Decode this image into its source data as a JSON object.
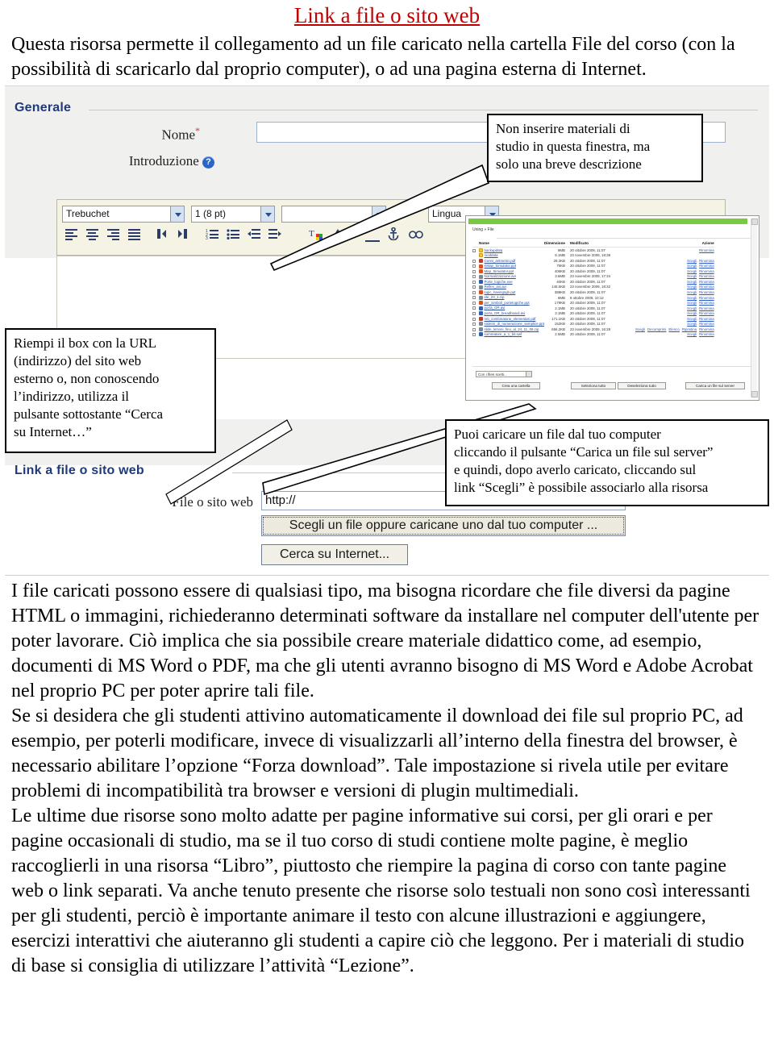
{
  "document": {
    "title": "Link a file o sito web",
    "intro": "Questa risorsa permette il collegamento ad un file caricato nella cartella File del corso (con la possibilità di scaricarlo dal proprio computer), o ad una pagina esterna di Internet.",
    "paragraph_1": "I file caricati possono essere di qualsiasi tipo, ma bisogna ricordare che file diversi da pagine HTML o immagini, richiederanno determinati software da installare nel computer dell'utente per poter lavorare. Ciò implica che sia possibile creare materiale didattico come, ad esempio, documenti di MS Word o PDF, ma che gli utenti avranno bisogno di MS Word e Adobe Acrobat nel proprio PC per poter aprire tali file.",
    "paragraph_2": "Se si desidera che gli studenti attivino automaticamente il download dei file sul proprio PC, ad esempio, per poterli modificare, invece di visualizzarli all’interno della finestra del browser, è necessario abilitare l’opzione “Forza download”. Tale impostazione si rivela utile per evitare problemi di incompatibilità tra browser e versioni di plugin multimediali.",
    "paragraph_3": "Le ultime due risorse sono molto adatte per pagine informative sui corsi, per gli orari e per pagine occasionali di studio, ma se il tuo corso di studi contiene molte pagine, è meglio raccoglierli in una risorsa  “Libro”, piuttosto che riempire la pagina di corso con tante pagine web o link separati. Va anche tenuto presente che risorse solo testuali non sono così interessanti per gli studenti, perciò è importante animare il testo con alcune illustrazioni e aggiungere, esercizi interattivi che aiuteranno gli studenti a capire ciò che leggono. Per i materiali di studio di base si consiglia di utilizzare l’attività “Lezione”."
  },
  "colors": {
    "title_red": "#c00000",
    "legend_blue": "#1f3a7a",
    "link_blue": "#2a4fa0",
    "green_bar": "#7ac943"
  },
  "screenshot": {
    "sections": {
      "generale": "Generale",
      "link_a_file": "Link a file o sito web"
    },
    "form": {
      "nome_label": "Nome",
      "nome_value": "",
      "nome_required_mark": "*",
      "introduzione_label": "Introduzione",
      "help_icon_glyph": "?",
      "file_o_sito_web_label": "File o sito web",
      "url_value": "http://",
      "choose_button": "Scegli un file oppure caricane uno dal tuo computer ...",
      "search_button": "Cerca su Internet..."
    },
    "editor": {
      "font_family": "Trebuchet",
      "font_size": "1 (8 pt)",
      "format": "",
      "language": "Lingua",
      "toolbar_icons": [
        "align-left-icon",
        "align-center-icon",
        "align-right-icon",
        "align-justify-icon",
        "direction-ltr-icon",
        "direction-rtl-icon",
        "numbered-list-icon",
        "bulleted-list-icon",
        "outdent-icon",
        "indent-icon",
        "text-color-icon",
        "background-color-icon",
        "horizontal-rule-icon",
        "anchor-icon",
        "insert-link-icon"
      ]
    },
    "file_manager": {
      "breadcrumb": "Uning » File",
      "columns": [
        "Nome",
        "Dimensione",
        "Modificato",
        "Azione"
      ],
      "rows": [
        {
          "checkbox": true,
          "icon": "folder-icon",
          "name": "backupdata",
          "size": "9MB",
          "modified": "20 ottobre 2009, 11:07",
          "actions": [
            "Rinomina"
          ]
        },
        {
          "checkbox": false,
          "icon": "folder-icon",
          "name": "moddata",
          "size": "8.1MB",
          "modified": "23 novembre 2009, 18:38",
          "actions": []
        },
        {
          "checkbox": true,
          "icon": "pdf-icon",
          "name": "Cenni_aritmetici.pdf",
          "size": "29.3KB",
          "modified": "20 ottobre 2009, 11:07",
          "actions": [
            "Scegli",
            "Rinomina"
          ]
        },
        {
          "checkbox": true,
          "icon": "ppt-icon",
          "name": "KMap_Simulator.ppt",
          "size": "75KB",
          "modified": "20 ottobre 2009, 11:07",
          "actions": [
            "Scegli",
            "Rinomina"
          ]
        },
        {
          "checkbox": true,
          "icon": "ppt-icon",
          "name": "Map_Simulator.ppt",
          "size": "406KB",
          "modified": "20 ottobre 2009, 11:07",
          "actions": [
            "Scegli",
            "Rinomina"
          ]
        },
        {
          "checkbox": true,
          "icon": "misc-icon",
          "name": "Normalizzazione.avi",
          "size": "3.6MB",
          "modified": "23 novembre 2009, 17:34",
          "actions": [
            "Scegli",
            "Rinomina"
          ]
        },
        {
          "checkbox": true,
          "icon": "doc-icon",
          "name": "Porte_logiche.exe",
          "size": "40KB",
          "modified": "20 ottobre 2009, 11:07",
          "actions": [
            "Scegli",
            "Rinomina"
          ]
        },
        {
          "checkbox": true,
          "icon": "misc-icon",
          "name": "Reflex_avi.avi",
          "size": "145.5KB",
          "modified": "23 novembre 2009, 18:32",
          "actions": [
            "Scegli",
            "Rinomina"
          ]
        },
        {
          "checkbox": true,
          "icon": "ppt-icon",
          "name": "logic_havingsgb.ppt",
          "size": "388KB",
          "modified": "20 ottobre 2009, 11:07",
          "actions": [
            "Scegli",
            "Rinomina"
          ]
        },
        {
          "checkbox": true,
          "icon": "misc-icon",
          "name": "ele_23_1.zip",
          "size": "6MB",
          "modified": "8 ottobre 2009, 10:12",
          "actions": [
            "Scegli",
            "Rinomina"
          ]
        },
        {
          "checkbox": true,
          "icon": "ppt-icon",
          "name": "per_simboli_portelogiche.ppt",
          "size": "179KB",
          "modified": "20 ottobre 2009, 11:07",
          "actions": [
            "Scegli",
            "Rinomina"
          ]
        },
        {
          "checkbox": true,
          "icon": "doc-icon",
          "name": "porta_OR.avi",
          "size": "2.1MB",
          "modified": "20 ottobre 2009, 11:07",
          "actions": [
            "Scegli",
            "Rinomina"
          ]
        },
        {
          "checkbox": true,
          "icon": "doc-icon",
          "name": "porta_OR_breadboard.avi",
          "size": "3.1MB",
          "modified": "20 ottobre 2009, 11:07",
          "actions": [
            "Scegli",
            "Rinomina"
          ]
        },
        {
          "checkbox": true,
          "icon": "pdf-icon",
          "name": "reti_combinatorie_elementari.pdf",
          "size": "171.1KB",
          "modified": "20 ottobre 2009, 11:07",
          "actions": [
            "Scegli",
            "Rinomina"
          ]
        },
        {
          "checkbox": true,
          "icon": "misc-icon",
          "name": "sistemi_di_numerazione_semplice.ppt",
          "size": "152KB",
          "modified": "20 ottobre 2009, 11:07",
          "actions": [
            "Scegli",
            "Rinomina"
          ]
        },
        {
          "checkbox": true,
          "icon": "misc-icon",
          "name": "slide_lezioni_fino_al_24_11_09.zip",
          "size": "656.2KB",
          "modified": "23 novembre 2009, 16:28",
          "actions": [
            "Scegli",
            "Decomprimi",
            "Elenco",
            "Ripristina",
            "Rinomina"
          ]
        },
        {
          "checkbox": true,
          "icon": "doc-icon",
          "name": "sommatore_a_1_bit.swf",
          "size": "2.6MB",
          "modified": "20 ottobre 2009, 11:07",
          "actions": [
            "Scegli",
            "Rinomina"
          ]
        }
      ],
      "bulk_select": "Con i files scelti...",
      "buttons": [
        "Crea una cartella",
        "Seleziona tutto",
        "Deseleziona tutto",
        "Carica un file sul server"
      ]
    }
  },
  "callouts": {
    "intro_note": "Non inserire materiali di\nstudio in questa finestra, ma\nsolo una breve descrizione",
    "url_note": "Riempi il box con la URL\n(indirizzo) del sito web\nesterno o, non conoscendo\nl’indirizzo, utilizza il\npulsante sottostante “Cerca\nsu Internet…”",
    "upload_note": "Puoi caricare un file dal tuo computer\ncliccando il pulsante “Carica un file sul server”\ne quindi, dopo averlo caricato,  cliccando sul\nlink  “Scegli” è possibile associarlo alla risorsa"
  }
}
